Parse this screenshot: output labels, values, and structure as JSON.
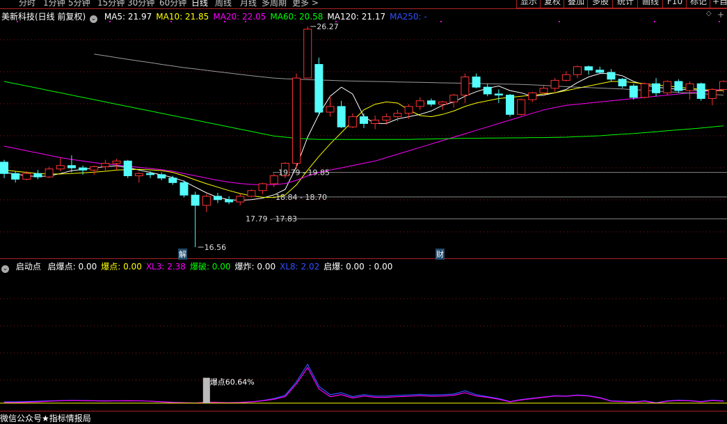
{
  "topbar": {
    "tabs": [
      "分时",
      "1分钟",
      "5分钟",
      "15分钟",
      "30分钟",
      "60分钟",
      "日线",
      "周线",
      "月线",
      "多周期",
      "更多 >"
    ],
    "active": "日线",
    "right_tabs": [
      "显示",
      "复权",
      "叠加",
      "多股",
      "统计",
      "画线",
      "F10",
      "标记",
      "+自"
    ]
  },
  "stock": {
    "title": "美新科技(日线 前复权)",
    "ma": [
      {
        "label": "MA5: 21.97",
        "color": "#ffffff"
      },
      {
        "label": "MA10: 21.85",
        "color": "#ffff00"
      },
      {
        "label": "MA20: 22.05",
        "color": "#ff00ff"
      },
      {
        "label": "MA60: 20.58",
        "color": "#00ff00"
      },
      {
        "label": "MA120: 21.17",
        "color": "#ffffff"
      },
      {
        "label": "MA250: -",
        "color": "#3050ff"
      }
    ]
  },
  "price_labels": {
    "high": "26.27",
    "low": "16.56",
    "levels": [
      "19.79 - 19.85",
      "18.84 - 18.70",
      "17.79 - 17.83"
    ]
  },
  "markers": {
    "m1": "解",
    "m2": "财"
  },
  "indicator": {
    "name": "启动点",
    "items": [
      {
        "label": "启爆点: 0.00",
        "color": "#ffffff"
      },
      {
        "label": "爆点: 0.00",
        "color": "#ffff00"
      },
      {
        "label": "XL3: 2.38",
        "color": "#ff00ff"
      },
      {
        "label": "爆破: 0.00",
        "color": "#00ff00"
      },
      {
        "label": "爆炸: 0.00",
        "color": "#ffffff"
      },
      {
        "label": "XL8: 2.02",
        "color": "#3050ff"
      },
      {
        "label": "启爆: 0.00",
        "color": "#ffffff"
      },
      {
        "label": ": 0.00",
        "color": "#ffffff"
      }
    ],
    "bar_label": "爆点60.64%"
  },
  "footer": "微信公众号★指标情报局",
  "colors": {
    "up": "#ff3232",
    "down": "#54fcfc",
    "grid": "#8b1a1a",
    "level": "#888888"
  },
  "chart_data": {
    "type": "candlestick",
    "price_ohlc": [
      [
        20.3,
        20.4,
        19.6,
        19.8
      ],
      [
        19.8,
        19.9,
        19.4,
        19.55
      ],
      [
        19.55,
        19.9,
        19.5,
        19.8
      ],
      [
        19.8,
        19.95,
        19.55,
        19.65
      ],
      [
        19.65,
        20.1,
        19.6,
        20.0
      ],
      [
        20.0,
        20.5,
        19.9,
        20.15
      ],
      [
        20.15,
        20.6,
        19.85,
        20.05
      ],
      [
        20.05,
        20.15,
        19.75,
        19.95
      ],
      [
        19.95,
        20.15,
        19.75,
        20.1
      ],
      [
        20.1,
        20.4,
        19.9,
        20.25
      ],
      [
        20.25,
        20.45,
        19.95,
        20.35
      ],
      [
        20.35,
        20.4,
        19.6,
        19.7
      ],
      [
        19.7,
        19.85,
        19.4,
        19.8
      ],
      [
        19.8,
        19.9,
        19.6,
        19.75
      ],
      [
        19.75,
        19.85,
        19.5,
        19.6
      ],
      [
        19.6,
        19.7,
        19.3,
        19.4
      ],
      [
        19.4,
        19.5,
        18.75,
        18.85
      ],
      [
        18.85,
        19.0,
        16.56,
        18.4
      ],
      [
        18.4,
        18.9,
        18.1,
        18.8
      ],
      [
        18.8,
        18.95,
        18.5,
        18.65
      ],
      [
        18.65,
        18.8,
        18.45,
        18.55
      ],
      [
        18.55,
        18.9,
        18.4,
        18.8
      ],
      [
        18.8,
        19.1,
        18.75,
        19.05
      ],
      [
        19.05,
        19.4,
        18.9,
        19.35
      ],
      [
        19.35,
        19.8,
        19.2,
        19.7
      ],
      [
        19.7,
        20.3,
        19.6,
        20.25
      ],
      [
        20.25,
        24.2,
        20.0,
        24.0
      ],
      [
        24.0,
        26.27,
        24.0,
        26.15
      ],
      [
        24.6,
        24.9,
        22.35,
        22.5
      ],
      [
        22.5,
        23.2,
        22.3,
        22.75
      ],
      [
        22.75,
        23.0,
        21.8,
        21.85
      ],
      [
        21.85,
        22.45,
        21.8,
        22.3
      ],
      [
        22.3,
        22.45,
        21.8,
        22.0
      ],
      [
        22.0,
        22.35,
        21.75,
        22.15
      ],
      [
        22.15,
        22.45,
        21.95,
        22.3
      ],
      [
        22.3,
        22.6,
        22.1,
        22.45
      ],
      [
        22.45,
        22.85,
        22.2,
        22.75
      ],
      [
        22.75,
        23.15,
        22.6,
        23.0
      ],
      [
        23.0,
        23.1,
        22.75,
        22.85
      ],
      [
        22.85,
        23.0,
        22.6,
        22.95
      ],
      [
        22.95,
        23.3,
        22.7,
        23.25
      ],
      [
        23.25,
        24.2,
        22.9,
        24.05
      ],
      [
        24.05,
        24.2,
        23.55,
        23.6
      ],
      [
        23.6,
        23.75,
        23.2,
        23.3
      ],
      [
        23.3,
        23.5,
        22.9,
        23.25
      ],
      [
        23.25,
        23.3,
        22.3,
        22.4
      ],
      [
        22.4,
        23.1,
        22.35,
        23.05
      ],
      [
        23.05,
        23.4,
        22.95,
        23.35
      ],
      [
        23.35,
        23.7,
        23.2,
        23.55
      ],
      [
        23.55,
        24.0,
        23.4,
        23.9
      ],
      [
        23.9,
        24.3,
        23.85,
        24.15
      ],
      [
        24.15,
        24.55,
        24.0,
        24.5
      ],
      [
        24.5,
        24.55,
        24.15,
        24.35
      ],
      [
        24.35,
        24.5,
        24.2,
        24.25
      ],
      [
        24.25,
        24.4,
        23.85,
        23.95
      ],
      [
        23.95,
        24.0,
        23.55,
        23.65
      ],
      [
        23.65,
        23.75,
        23.05,
        23.15
      ],
      [
        23.15,
        23.8,
        23.1,
        23.75
      ],
      [
        23.75,
        24.0,
        23.2,
        23.35
      ],
      [
        23.35,
        23.9,
        23.25,
        23.85
      ],
      [
        23.85,
        23.95,
        23.35,
        23.45
      ],
      [
        23.45,
        23.85,
        23.05,
        23.75
      ],
      [
        23.75,
        23.8,
        23.0,
        23.1
      ],
      [
        23.1,
        23.55,
        22.8,
        23.5
      ],
      [
        23.5,
        23.9,
        23.35,
        23.85
      ]
    ],
    "ma": {
      "MA5": [
        19.85,
        19.78,
        19.7,
        19.67,
        19.69,
        19.8,
        19.92,
        19.98,
        20.05,
        20.1,
        20.14,
        20.06,
        19.95,
        19.85,
        19.74,
        19.63,
        19.46,
        19.2,
        18.95,
        18.75,
        18.65,
        18.62,
        18.65,
        18.72,
        18.86,
        19.1,
        20.1,
        21.4,
        22.4,
        23.2,
        23.6,
        23.3,
        22.3,
        22.0,
        22.0,
        22.2,
        22.3,
        22.4,
        22.55,
        22.8,
        22.95,
        23.2,
        23.4,
        23.55,
        23.65,
        23.45,
        23.35,
        23.2,
        23.25,
        23.35,
        23.5,
        23.8,
        24.05,
        24.2,
        24.2,
        24.1,
        23.85,
        23.7,
        23.6,
        23.55,
        23.5,
        23.5,
        23.45,
        23.45,
        23.5
      ],
      "MA10": [
        19.95,
        19.9,
        19.85,
        19.8,
        19.78,
        19.78,
        19.8,
        19.83,
        19.86,
        19.9,
        19.95,
        19.97,
        19.98,
        19.96,
        19.93,
        19.85,
        19.7,
        19.52,
        19.35,
        19.2,
        19.05,
        18.92,
        18.82,
        18.76,
        18.74,
        18.85,
        19.3,
        19.95,
        20.55,
        21.1,
        21.6,
        22.1,
        22.6,
        22.85,
        22.95,
        22.9,
        22.6,
        22.35,
        22.3,
        22.4,
        22.55,
        22.75,
        22.9,
        23.0,
        23.1,
        23.15,
        23.2,
        23.25,
        23.3,
        23.35,
        23.45,
        23.55,
        23.65,
        23.75,
        23.85,
        23.85,
        23.8,
        23.75,
        23.7,
        23.65,
        23.6,
        23.55,
        23.5,
        23.45,
        23.45
      ],
      "MA20": [
        21.0,
        20.9,
        20.8,
        20.7,
        20.6,
        20.5,
        20.42,
        20.35,
        20.28,
        20.22,
        20.18,
        20.12,
        20.07,
        20.02,
        19.97,
        19.9,
        19.8,
        19.7,
        19.6,
        19.5,
        19.42,
        19.36,
        19.32,
        19.3,
        19.31,
        19.36,
        19.5,
        19.7,
        19.85,
        19.95,
        20.05,
        20.15,
        20.25,
        20.35,
        20.5,
        20.65,
        20.8,
        20.95,
        21.1,
        21.25,
        21.4,
        21.55,
        21.7,
        21.85,
        22.0,
        22.15,
        22.3,
        22.45,
        22.6,
        22.7,
        22.8,
        22.85,
        22.9,
        22.95,
        23.0,
        23.05,
        23.1,
        23.15,
        23.2,
        23.25,
        23.3,
        23.35,
        23.4,
        23.45,
        23.5
      ],
      "MA60": [
        23.85,
        23.75,
        23.65,
        23.55,
        23.45,
        23.35,
        23.25,
        23.15,
        23.05,
        22.95,
        22.85,
        22.75,
        22.65,
        22.55,
        22.45,
        22.35,
        22.25,
        22.15,
        22.05,
        21.95,
        21.85,
        21.75,
        21.65,
        21.55,
        21.45,
        21.4,
        21.35,
        21.32,
        21.3,
        21.3,
        21.3,
        21.3,
        21.3,
        21.3,
        21.3,
        21.3,
        21.3,
        21.31,
        21.32,
        21.33,
        21.34,
        21.35,
        21.35,
        21.36,
        21.36,
        21.37,
        21.37,
        21.38,
        21.38,
        21.39,
        21.4,
        21.42,
        21.44,
        21.46,
        21.5,
        21.53,
        21.56,
        21.6,
        21.64,
        21.68,
        21.72,
        21.76,
        21.8,
        21.85,
        21.9
      ],
      "MA120": [
        null,
        null,
        null,
        null,
        null,
        null,
        null,
        null,
        25.05,
        24.98,
        24.9,
        24.82,
        24.75,
        24.68,
        24.6,
        24.53,
        24.46,
        24.4,
        24.34,
        24.28,
        24.22,
        24.16,
        24.1,
        24.05,
        24.0,
        23.97,
        23.95,
        23.93,
        23.91,
        23.9,
        23.88,
        23.87,
        23.86,
        23.85,
        23.84,
        23.83,
        23.82,
        23.81,
        23.8,
        23.79,
        23.78,
        23.77,
        23.76,
        23.75,
        23.74,
        23.73,
        23.72,
        23.7,
        23.68,
        23.65,
        23.62,
        23.6,
        23.58,
        23.56,
        23.54,
        23.52,
        23.49,
        23.46,
        23.43,
        23.4,
        23.37,
        23.34,
        23.31,
        23.28,
        23.25
      ]
    },
    "indicator": {
      "XL3": [
        0.1,
        0.1,
        0.15,
        0.2,
        0.3,
        0.35,
        0.4,
        0.38,
        0.35,
        0.32,
        0.35,
        0.38,
        0.35,
        0.3,
        0.2,
        0.1,
        0.05,
        0.0,
        0.15,
        0.1,
        0.05,
        0.1,
        0.2,
        0.35,
        0.6,
        1.0,
        3.0,
        5.5,
        2.2,
        1.0,
        1.3,
        0.8,
        1.1,
        0.9,
        0.9,
        1.0,
        1.05,
        1.15,
        1.05,
        1.1,
        1.2,
        1.6,
        1.1,
        0.9,
        0.6,
        0.2,
        0.5,
        0.7,
        0.9,
        1.1,
        1.05,
        1.2,
        1.1,
        0.8,
        0.3,
        0.25,
        0.15,
        0.3,
        0.0,
        0.3,
        0.4,
        0.35,
        0.2,
        0.4,
        0.3
      ],
      "XL8": [
        0.2,
        0.2,
        0.25,
        0.3,
        0.35,
        0.4,
        0.42,
        0.4,
        0.38,
        0.36,
        0.37,
        0.38,
        0.36,
        0.3,
        0.22,
        0.12,
        0.05,
        0.0,
        0.1,
        0.08,
        0.05,
        0.1,
        0.2,
        0.4,
        0.7,
        1.2,
        3.3,
        6.0,
        2.6,
        1.3,
        1.6,
        1.0,
        1.3,
        1.1,
        1.1,
        1.2,
        1.25,
        1.35,
        1.25,
        1.3,
        1.4,
        1.9,
        1.3,
        1.0,
        0.7,
        0.25,
        0.55,
        0.75,
        0.95,
        1.15,
        1.1,
        1.25,
        1.15,
        0.85,
        0.35,
        0.3,
        0.2,
        0.35,
        0.05,
        0.35,
        0.45,
        0.4,
        0.25,
        0.45,
        0.35
      ],
      "bar_index": 18,
      "bar_value": 60.64
    }
  }
}
